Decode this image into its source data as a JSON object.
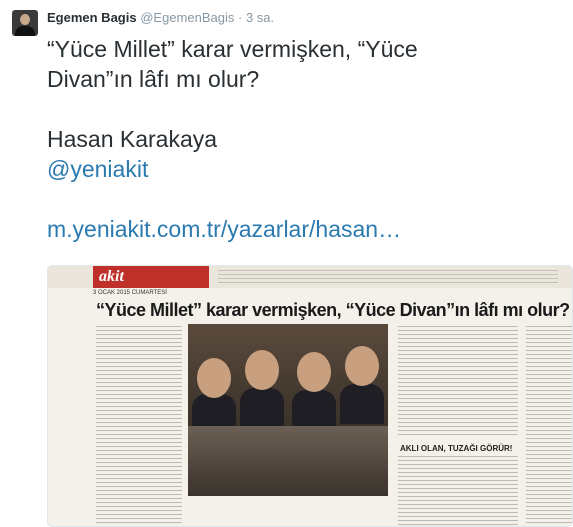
{
  "tweet": {
    "author_name": "Egemen Bagis",
    "author_handle": "@EgemenBagis",
    "separator": "·",
    "time": "3 sa.",
    "lines": [
      "“Yüce Millet” karar vermişken, “Yüce",
      "Divan”ın lâfı mı olur?",
      "Hasan Karakaya"
    ],
    "mention": "@yeniakit",
    "link": "m.yeniakit.com.tr/yazarlar/hasan…"
  },
  "media": {
    "paper_logo": "akit",
    "date": "3 OCAK 2015 CUMARTESİ",
    "headline": "“Yüce Millet” karar vermişken, “Yüce Divan”ın lâfı mı olur?",
    "subhead": "AKLI OLAN, TUZAĞI GÖRÜR!"
  },
  "colors": {
    "text": "#292f33",
    "secondary": "#8899a6",
    "link": "#2a7ab0"
  }
}
